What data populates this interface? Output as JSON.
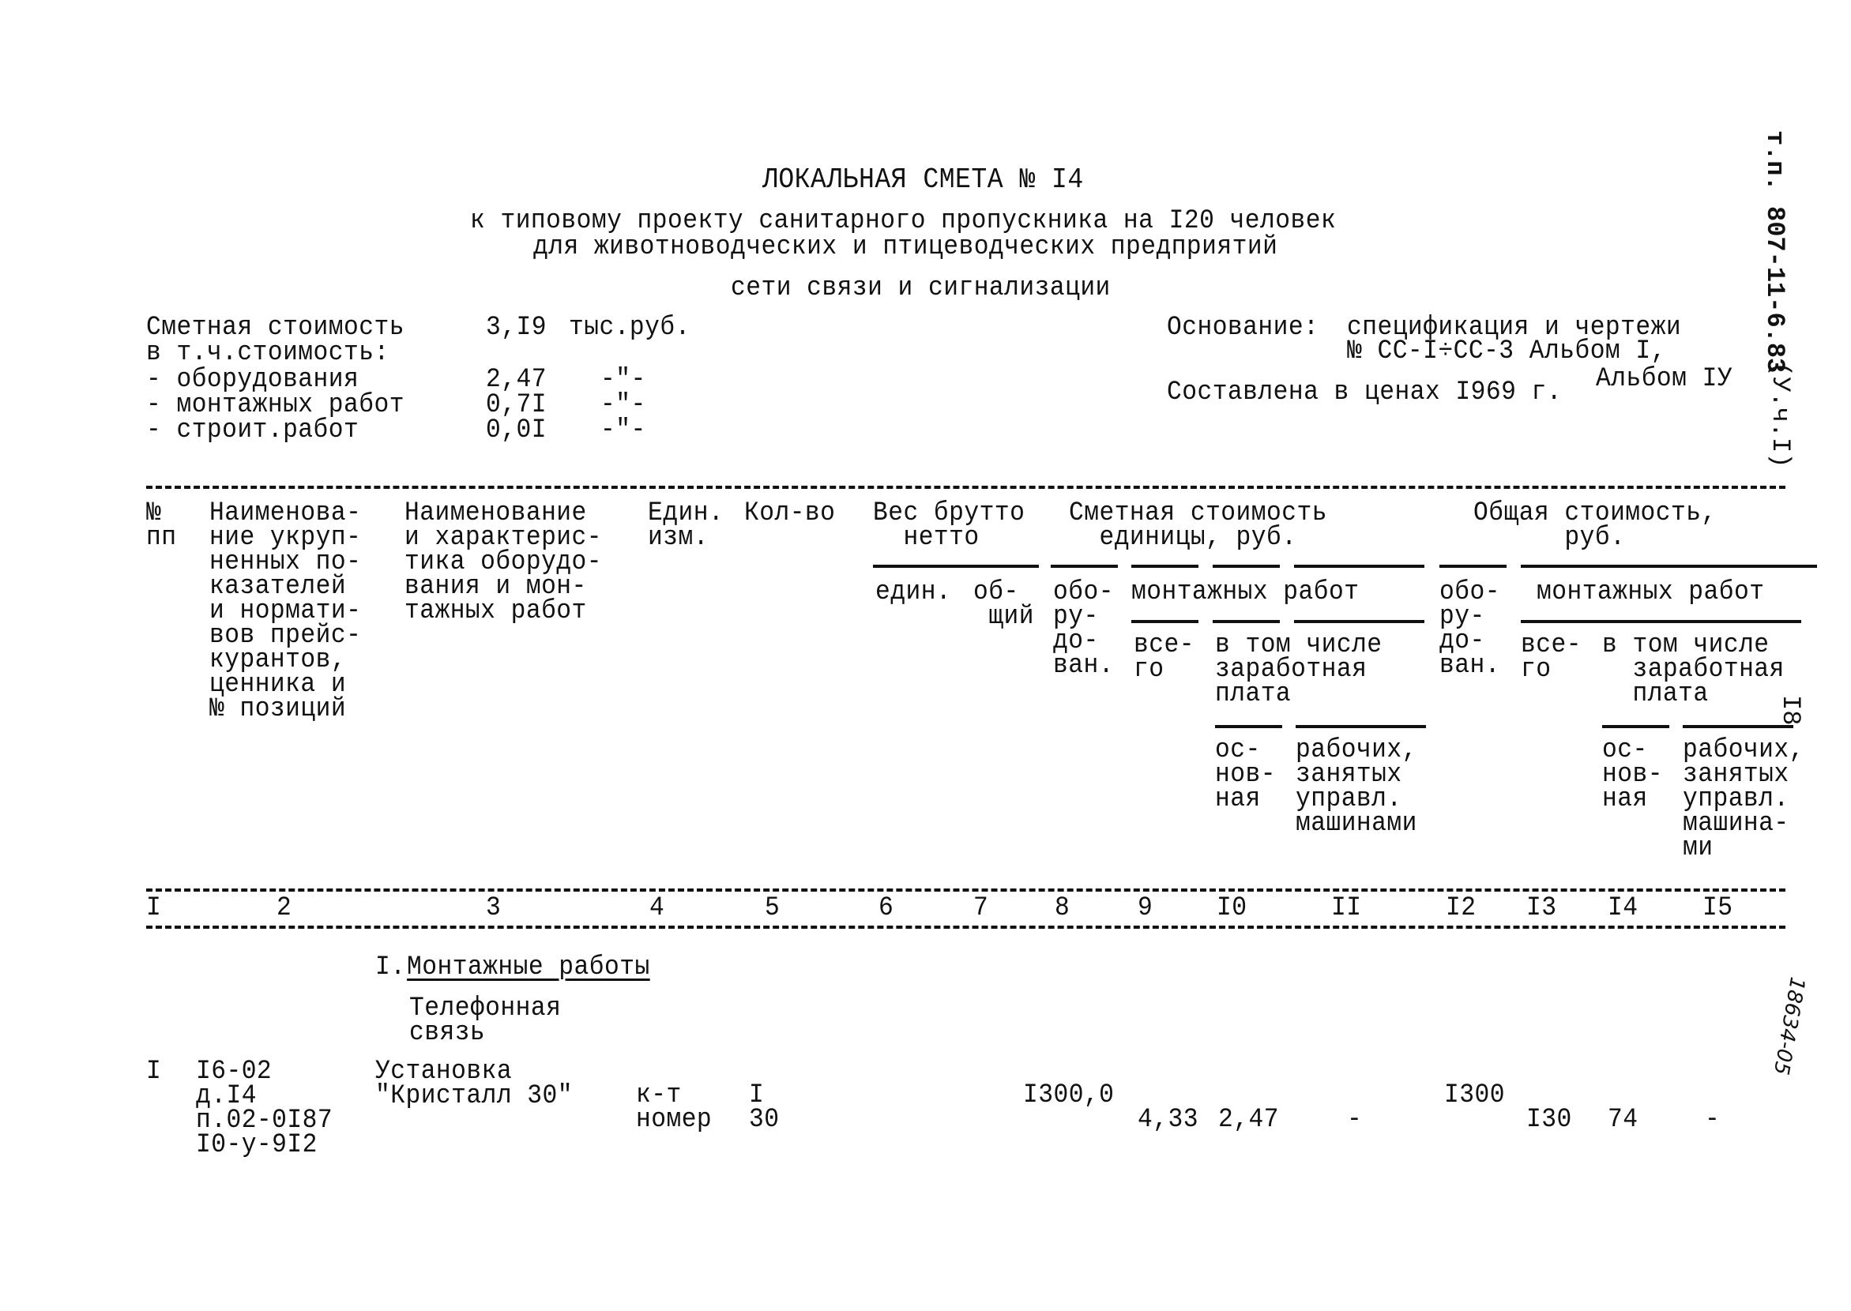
{
  "document": {
    "title": "ЛОКАЛЬНАЯ СМЕТА № I4",
    "subtitle_line1": "к типовому проекту санитарного пропускника на I20 человек",
    "subtitle_line2": "для животноводческих и птицеводческих предприятий",
    "section_title": "сети связи и сигнализации",
    "side_code": "т.п. 807-11-6.83",
    "side_volume": "(У.ч.I)",
    "page_number": "I8",
    "archive_number": "18634-05"
  },
  "summary": {
    "rows": [
      {
        "label": "Сметная стоимость",
        "value": "3,I9",
        "unit": "тыс.руб."
      },
      {
        "label": "в т.ч.стоимость:",
        "value": "",
        "unit": ""
      },
      {
        "label": "- оборудования",
        "value": "2,47",
        "unit": "-\"-"
      },
      {
        "label": "- монтажных работ",
        "value": "0,7I",
        "unit": "-\"-"
      },
      {
        "label": "- строит.работ",
        "value": "0,0I",
        "unit": "-\"-"
      }
    ],
    "basis_label": "Основание:",
    "basis_line1": "спецификация и чертежи",
    "basis_line2": "№ СС-I÷СС-3 Альбом I,",
    "basis_line3": "Альбом IУ",
    "prices": "Составлена в ценах I969 г."
  },
  "table": {
    "headers": {
      "c1": "№\nпп",
      "c2": "Наименова-\nние укруп-\nненных по-\nказателей\nи нормати-\nвов прейс-\nкурантов,\nценника и\n№ позиций",
      "c3": "Наименование\nи характерис-\nтика оборудо-\nвания и мон-\nтажных работ",
      "c4": "Един.\nизм.",
      "c5": "Кол-во",
      "weight": "Вес брутто\n  нетто",
      "weight_unit": "един.",
      "weight_total": "об-\n щий",
      "unit_cost": "Сметная стоимость\n  единицы, руб.",
      "equip": "обо-\nру-\nдо-\nван.",
      "mount": "монтажных работ",
      "total": "все-\nго",
      "incl": "в том числе\nзаработная\nплата",
      "incl_total": "в том числе\n  заработная\n  плата",
      "basic": "ос-\nнов-\nная",
      "machines": "рабочих,\nзанятых\nуправл.\nмашинами",
      "machines_total": "рабочих,\nзанятых\nуправл.\nмашина-\nми",
      "total_cost": "Общая стоимость,\n      руб."
    },
    "column_numbers": [
      "I",
      "2",
      "3",
      "4",
      "5",
      "6",
      "7",
      "8",
      "9",
      "I0",
      "II",
      "I2",
      "I3",
      "I4",
      "I5"
    ],
    "section": "I.",
    "section_name": "Монтажные работы",
    "subsection": "Телефонная\nсвязь",
    "rows": [
      {
        "num": "I",
        "code": "I6-02\nд.I4\nп.02-0I87\nI0-у-9I2",
        "name": "Установка\n\"Кристалл 30\"",
        "unit": "к-т\nномер",
        "qty": "I\n30",
        "c8": "I300,0",
        "c9": "4,33",
        "c10": "2,47",
        "c11": "-",
        "c12": "I300",
        "c13": "I30",
        "c14": "74",
        "c15": "-"
      }
    ]
  }
}
